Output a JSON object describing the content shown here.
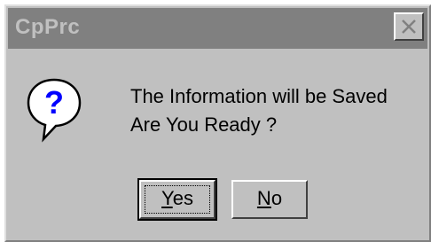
{
  "dialog": {
    "title": "CpPrc",
    "message_line1": "The Information will be Saved",
    "message_line2": "Are You Ready ?",
    "icon": "question-icon",
    "buttons": {
      "yes_mnemonic": "Y",
      "yes_rest": "es",
      "no_mnemonic": "N",
      "no_rest": "o"
    }
  },
  "colors": {
    "face": "#c0c0c0",
    "titlebar_inactive": "#808080",
    "icon_blue": "#0000ff"
  }
}
